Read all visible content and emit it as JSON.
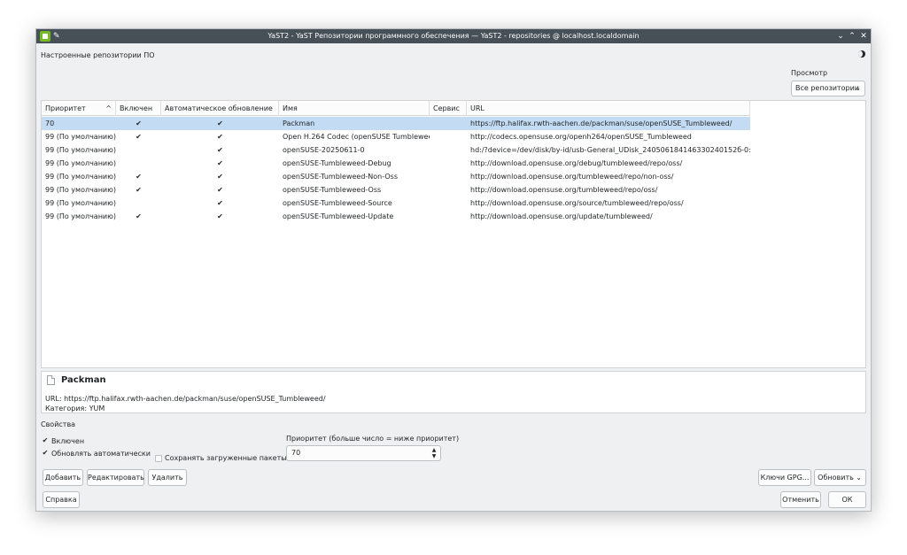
{
  "window": {
    "title": "YaST2 - YaST Репозитории программного обеспечения — YaST2 - repositories @ localhost.localdomain",
    "controls": {
      "minimize": "⌄",
      "maximize": "⌃",
      "close": "✕"
    }
  },
  "header": {
    "title": "Настроенные репозитории ПО"
  },
  "view": {
    "label": "Просмотр",
    "selected": "Все репозитории"
  },
  "table": {
    "columns": [
      "Приоритет",
      "Включен",
      "Автоматическое обновление",
      "Имя",
      "Сервис",
      "URL"
    ],
    "sort_indicator": "^",
    "check_glyph": "✔",
    "rows": [
      {
        "priority": "70",
        "enabled": true,
        "autorefresh": true,
        "name": "Packman",
        "service": "",
        "url": "https://ftp.halifax.rwth-aachen.de/packman/suse/openSUSE_Tumbleweed/"
      },
      {
        "priority": "99 (По умолчанию)",
        "enabled": true,
        "autorefresh": true,
        "name": "Open H.264 Codec (openSUSE Tumbleweed)",
        "service": "",
        "url": "http://codecs.opensuse.org/openh264/openSUSE_Tumbleweed"
      },
      {
        "priority": "99 (По умолчанию)",
        "enabled": false,
        "autorefresh": true,
        "name": "openSUSE-20250611-0",
        "service": "",
        "url": "hd:/?device=/dev/disk/by-id/usb-General_UDisk_240506184146330240152б-0:0-part2"
      },
      {
        "priority": "99 (По умолчанию)",
        "enabled": false,
        "autorefresh": true,
        "name": "openSUSE-Tumbleweed-Debug",
        "service": "",
        "url": "http://download.opensuse.org/debug/tumbleweed/repo/oss/"
      },
      {
        "priority": "99 (По умолчанию)",
        "enabled": true,
        "autorefresh": true,
        "name": "openSUSE-Tumbleweed-Non-Oss",
        "service": "",
        "url": "http://download.opensuse.org/tumbleweed/repo/non-oss/"
      },
      {
        "priority": "99 (По умолчанию)",
        "enabled": true,
        "autorefresh": true,
        "name": "openSUSE-Tumbleweed-Oss",
        "service": "",
        "url": "http://download.opensuse.org/tumbleweed/repo/oss/"
      },
      {
        "priority": "99 (По умолчанию)",
        "enabled": false,
        "autorefresh": true,
        "name": "openSUSE-Tumbleweed-Source",
        "service": "",
        "url": "http://download.opensuse.org/source/tumbleweed/repo/oss/"
      },
      {
        "priority": "99 (По умолчанию)",
        "enabled": true,
        "autorefresh": true,
        "name": "openSUSE-Tumbleweed-Update",
        "service": "",
        "url": "http://download.opensuse.org/update/tumbleweed/"
      }
    ]
  },
  "details": {
    "title": "Packman",
    "url_line": "URL: https://ftp.halifax.rwth-aachen.de/packman/suse/openSUSE_Tumbleweed/",
    "category_line": "Категория: YUM"
  },
  "properties": {
    "label": "Свойства",
    "enabled_label": "Включен",
    "autorefresh_label": "Обновлять автоматически",
    "keep_packages_label": "Сохранять загруженные пакеты",
    "priority_label": "Приоритет (больше число = ниже приоритет)",
    "priority_value": "70"
  },
  "buttons": {
    "add": "Добавить",
    "edit": "Редактировать",
    "delete": "Удалить",
    "gpg": "Ключи GPG...",
    "refresh": "Обновить",
    "help": "Справка",
    "cancel": "Отменить",
    "ok": "ОК"
  }
}
